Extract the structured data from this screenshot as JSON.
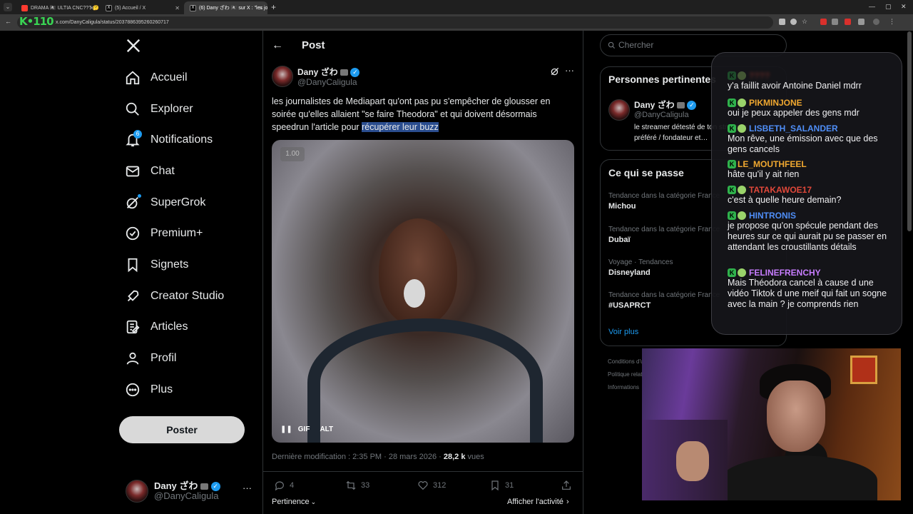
{
  "browser": {
    "tabs": [
      {
        "title": "DRAMA 🏴‍☠️ ULTIA CNC??? 🤔🚽",
        "favicon_color": "#ff3b30",
        "active": false
      },
      {
        "title": "(5) Accueil / X",
        "favicon_color": "#ffffff",
        "active": false
      },
      {
        "title": "(6) Dany ざわ 🏴‍☠️ sur X : \"les jou...",
        "favicon_color": "#ffffff",
        "active": true
      }
    ],
    "new_tab_label": "+",
    "url": "x.com/DanyCaligula/status/2037886395260260717",
    "overlay_logo": "K•110"
  },
  "nav": {
    "logo": "X",
    "items": [
      {
        "label": "Accueil",
        "icon": "home-icon"
      },
      {
        "label": "Explorer",
        "icon": "search-icon"
      },
      {
        "label": "Notifications",
        "icon": "bell-icon",
        "badge": "6"
      },
      {
        "label": "Chat",
        "icon": "mail-icon"
      },
      {
        "label": "SuperGrok",
        "icon": "grok-icon"
      },
      {
        "label": "Premium+",
        "icon": "verified-icon"
      },
      {
        "label": "Signets",
        "icon": "bookmark-icon"
      },
      {
        "label": "Creator Studio",
        "icon": "rocket-icon"
      },
      {
        "label": "Articles",
        "icon": "article-icon"
      },
      {
        "label": "Profil",
        "icon": "person-icon"
      },
      {
        "label": "Plus",
        "icon": "more-circle-icon"
      }
    ],
    "post_button": "Poster",
    "account": {
      "name": "Dany ざわ",
      "handle": "@DanyCaligula",
      "more": "···"
    }
  },
  "post": {
    "header_title": "Post",
    "author_name": "Dany ざわ",
    "author_handle": "@DanyCaligula",
    "text_before": "les journalistes de Mediapart qu'ont pas pu s'empêcher de glousser en soirée qu'elles allaient \"se faire Theodora\" et qui doivent désormais speedrun l'article pour ",
    "text_highlight": "récupérer leur buzz",
    "media": {
      "speed": "1.00",
      "gif_label": "GIF",
      "alt_label": "ALT"
    },
    "meta_prefix": "Dernière modification : 2:35 PM · 28 mars 2026 · ",
    "views_value": "28,2 k",
    "views_label": " vues",
    "stats": {
      "replies": "4",
      "reposts": "33",
      "likes": "312",
      "bookmarks": "31"
    },
    "relevance": "Pertinence",
    "activity": "Afficher l'activité"
  },
  "right": {
    "search_placeholder": "Chercher",
    "people_title": "Personnes pertinentes",
    "person": {
      "name": "Dany ざわ",
      "handle": "@DanyCaligula",
      "bio1": "le streamer détesté de ton streamer",
      "bio2": "préféré / fondateur et…"
    },
    "happening_title": "Ce qui se passe",
    "trends": [
      {
        "category": "Tendance dans la catégorie France",
        "name": "Michou"
      },
      {
        "category": "Tendance dans la catégorie France",
        "name": "Dubaï"
      },
      {
        "category": "Voyage · Tendances",
        "name": "Disneyland"
      },
      {
        "category": "Tendance dans la catégorie France",
        "name": "#USAPRCT"
      }
    ],
    "see_more": "Voir plus",
    "footer": [
      "Conditions d'utilisation",
      "Politique relative",
      "Informations"
    ]
  },
  "chat": {
    "messages": [
      {
        "user": "????",
        "color": "#e0483a",
        "text": "y'a faillit avoir Antoine Daniel mdrr"
      },
      {
        "user": "PIKMINJONE",
        "color": "#f0a830",
        "text": "oui je peux appeler des gens mdr"
      },
      {
        "user": "LISBETH_SALANDER",
        "color": "#4f8ef7",
        "text": "Mon rêve, une émission avec que des gens cancels"
      },
      {
        "user": "LE_MOUTHFEEL",
        "color": "#f0a830",
        "text": "hâte qu'il y ait rien"
      },
      {
        "user": "TATAKAWOE17",
        "color": "#e0483a",
        "text": "c'est à quelle heure demain?"
      },
      {
        "user": "HINTRONIS",
        "color": "#4f8ef7",
        "text": "je propose qu'on spécule pendant des heures sur ce qui aurait pu se passer en attendant les croustillants détails"
      },
      {
        "user": "FELINEFRENCHY",
        "color": "#c77dff",
        "text": "Mais Théodora cancel à cause d une vidéo Tiktok d une meif qui fait un sogne avec la main ? je comprends rien"
      }
    ]
  }
}
